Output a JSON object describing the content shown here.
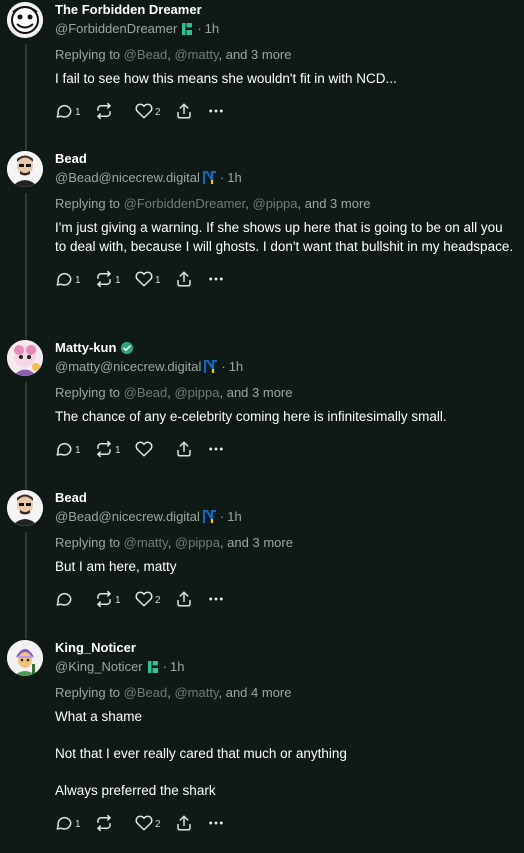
{
  "posts": [
    {
      "name": "The Forbidden Dreamer",
      "handle": "@ForbiddenDreamer",
      "instance_icon": "pleroma-icon",
      "time": "1h",
      "replying_prefix": "Replying to",
      "mentions": [
        "@Bead",
        "@matty"
      ],
      "replying_more": "and 3 more",
      "paragraphs": [
        "I fail to see how this means she wouldn't fit in with NCD..."
      ],
      "replies": "1",
      "reblogs": "",
      "likes": "2",
      "avatar": "dreamer-avatar"
    },
    {
      "name": "Bead",
      "handle": "@Bead@nicecrew.digital",
      "instance_icon": "nicecrew-icon",
      "time": "1h",
      "replying_prefix": "Replying to",
      "mentions": [
        "@ForbiddenDreamer",
        "@pippa"
      ],
      "replying_more": "and 3 more",
      "paragraphs": [
        "I'm just giving a warning. If she shows up here that is going to be on all you to deal with, because I will ghosts. I don't want that bullshit in my headspace."
      ],
      "replies": "1",
      "reblogs": "1",
      "likes": "1",
      "avatar": "bead-avatar"
    },
    {
      "name": "Matty-kun",
      "handle": "@matty@nicecrew.digital",
      "instance_icon": "nicecrew-icon",
      "time": "1h",
      "replying_prefix": "Replying to",
      "mentions": [
        "@Bead",
        "@pippa"
      ],
      "replying_more": "and 3 more",
      "paragraphs": [
        "The chance of any e-celebrity coming here is infinitesimally small."
      ],
      "replies": "1",
      "reblogs": "1",
      "likes": "",
      "avatar": "matty-avatar",
      "verified": true
    },
    {
      "name": "Bead",
      "handle": "@Bead@nicecrew.digital",
      "instance_icon": "nicecrew-icon",
      "time": "1h",
      "replying_prefix": "Replying to",
      "mentions": [
        "@matty",
        "@pippa"
      ],
      "replying_more": "and 3 more",
      "paragraphs": [
        "But I am here, matty"
      ],
      "replies": "",
      "reblogs": "1",
      "likes": "2",
      "avatar": "bead-avatar"
    },
    {
      "name": "King_Noticer",
      "handle": "@King_Noticer",
      "instance_icon": "pleroma-icon",
      "time": "1h",
      "replying_prefix": "Replying to",
      "mentions": [
        "@Bead",
        "@matty"
      ],
      "replying_more": "and 4 more",
      "paragraphs": [
        "What a shame",
        "Not that I ever really cared that much or anything",
        "Always preferred the shark"
      ],
      "replies": "1",
      "reblogs": "",
      "likes": "2",
      "avatar": "king-avatar"
    }
  ],
  "dot_separator": "·",
  "colors": {
    "background": "#0f1a17",
    "muted": "#9aa8a4",
    "pleroma": "#33c08f",
    "nicecrew_blue": "#1565c0",
    "verified": "#2fa37f"
  }
}
